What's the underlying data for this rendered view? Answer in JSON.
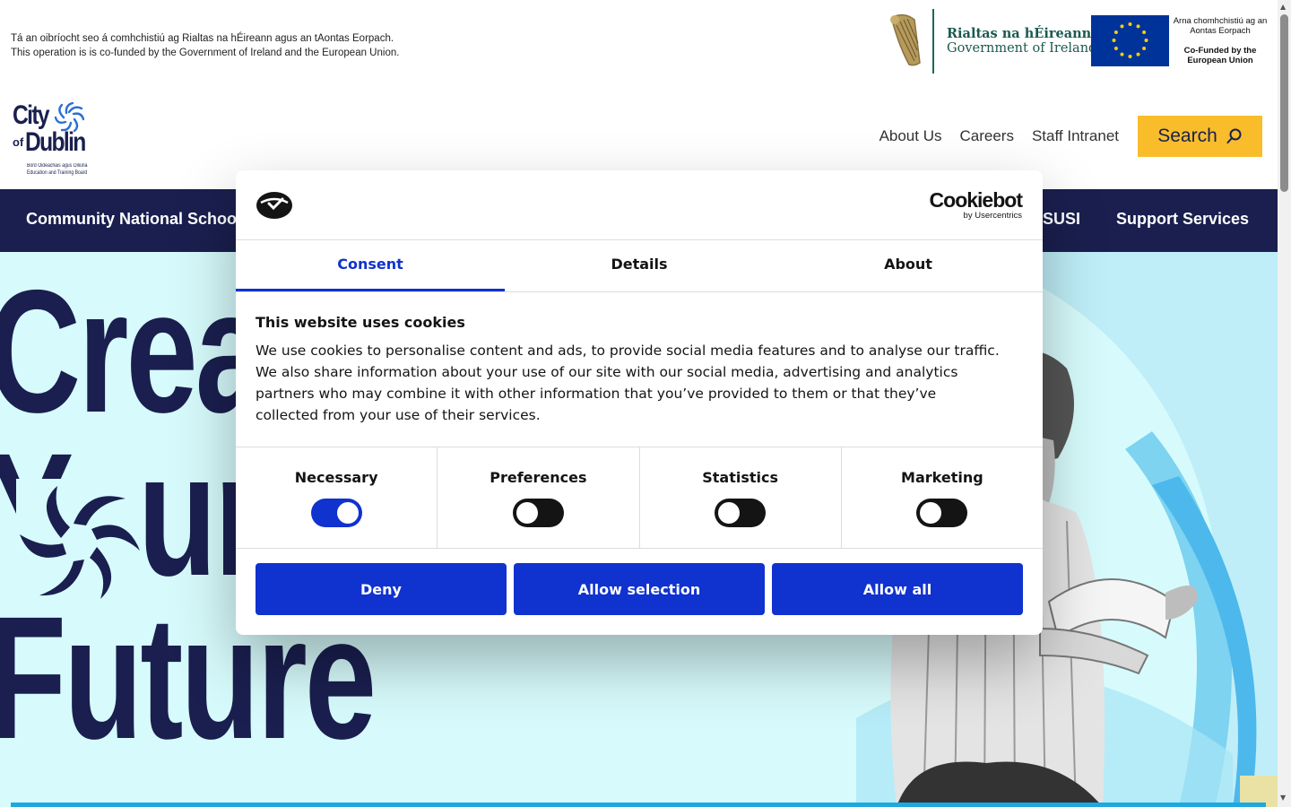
{
  "funding": {
    "irish_line": "Tá an oibríocht seo á comhchistiú ag Rialtas na hÉireann agus an tAontas Eorpach.",
    "english_line": "This operation is is co-funded by the Government of Ireland and the European Union.",
    "gov_irish": "Rialtas na hÉireann",
    "gov_english": "Government of Ireland",
    "eu_irish": "Arna chomhchistiú ag an Aontas Eorpach",
    "eu_english": "Co-Funded by the European Union"
  },
  "header": {
    "logo": {
      "city": "City",
      "of": "of",
      "dublin": "Dublin",
      "sub_irish": "Bord Oideachais agus Oiliúna",
      "sub_english": "Education and Training Board"
    },
    "links": [
      "About Us",
      "Careers",
      "Staff Intranet"
    ],
    "search_label": "Search"
  },
  "nav": {
    "items": [
      "Community National Schools",
      "SUSI",
      "Support Services"
    ]
  },
  "hero": {
    "line1": "Create",
    "line2": "Your",
    "line3": "Future"
  },
  "cookie": {
    "brand_name": "Cookiebot",
    "brand_by": "by Usercentrics",
    "tabs": [
      "Consent",
      "Details",
      "About"
    ],
    "active_tab": "Consent",
    "title": "This website uses cookies",
    "description": "We use cookies to personalise content and ads, to provide social media features and to analyse our traffic. We also share information about your use of our site with our social media, advertising and analytics partners who may combine it with other information that you’ve provided to them or that they’ve collected from your use of their services.",
    "categories": [
      {
        "label": "Necessary",
        "enabled": true
      },
      {
        "label": "Preferences",
        "enabled": false
      },
      {
        "label": "Statistics",
        "enabled": false
      },
      {
        "label": "Marketing",
        "enabled": false
      }
    ],
    "buttons": {
      "deny": "Deny",
      "allow_selection": "Allow selection",
      "allow_all": "Allow all"
    }
  },
  "colors": {
    "navy": "#1a1f4f",
    "accent_yellow": "#f9bd2b",
    "cookie_blue": "#1032cf",
    "hero_bg": "#d7fbfc",
    "hero_bar": "#1ea8e0"
  }
}
